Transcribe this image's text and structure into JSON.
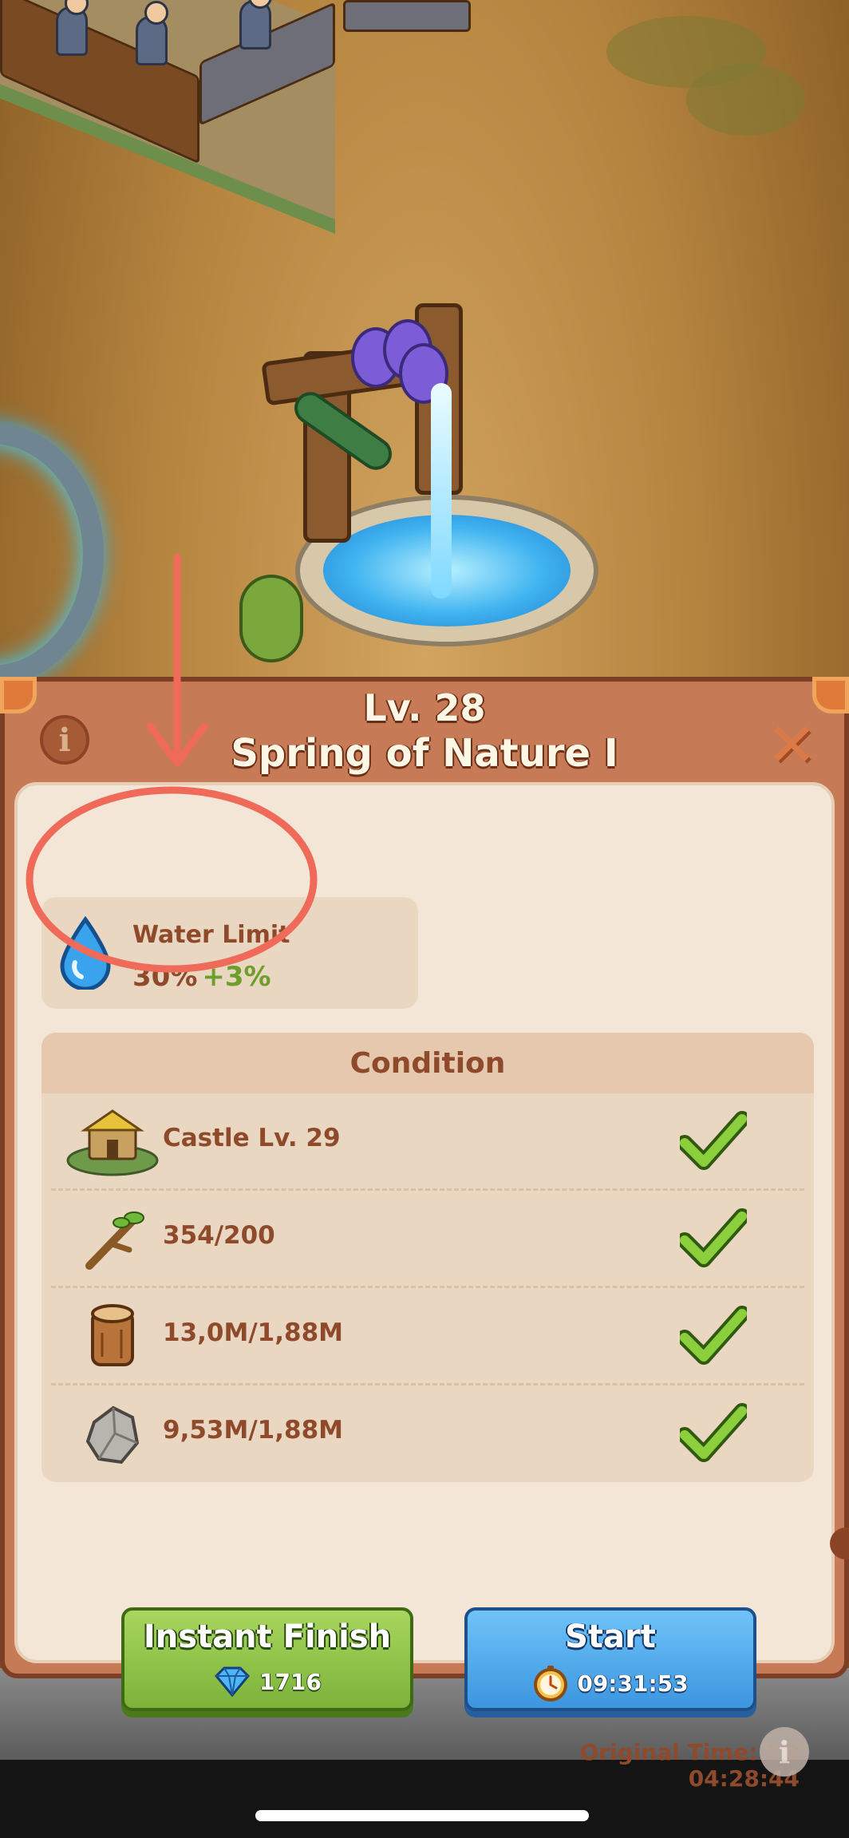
{
  "building": {
    "level": "Lv. 28",
    "name": "Spring of Nature I"
  },
  "stat": {
    "icon": "water-drop-icon",
    "label": "Water Limit",
    "value": "30%",
    "bonus": "+3%"
  },
  "conditions": {
    "title": "Condition",
    "rows": [
      {
        "icon": "castle-icon",
        "text": "Castle Lv. 29",
        "met": true
      },
      {
        "icon": "branch-icon",
        "text": "354/200",
        "met": true
      },
      {
        "icon": "wood-log-icon",
        "text": "13,0M/1,88M",
        "met": true
      },
      {
        "icon": "stone-icon",
        "text": "9,53M/1,88M",
        "met": true
      }
    ]
  },
  "actions": {
    "instant_finish": {
      "label": "Instant Finish",
      "cost": "1716",
      "icon": "diamond-icon"
    },
    "start": {
      "label": "Start",
      "time": "09:31:53",
      "icon": "clock-icon"
    }
  },
  "original_time": "Original Time: 1D 04:28:44",
  "colors": {
    "panel": "#c67a55",
    "body": "#f3e6d6",
    "text_brown": "#8e4a2a",
    "bonus_green": "#6e9e2c",
    "annotation_red": "#f06a5a"
  }
}
